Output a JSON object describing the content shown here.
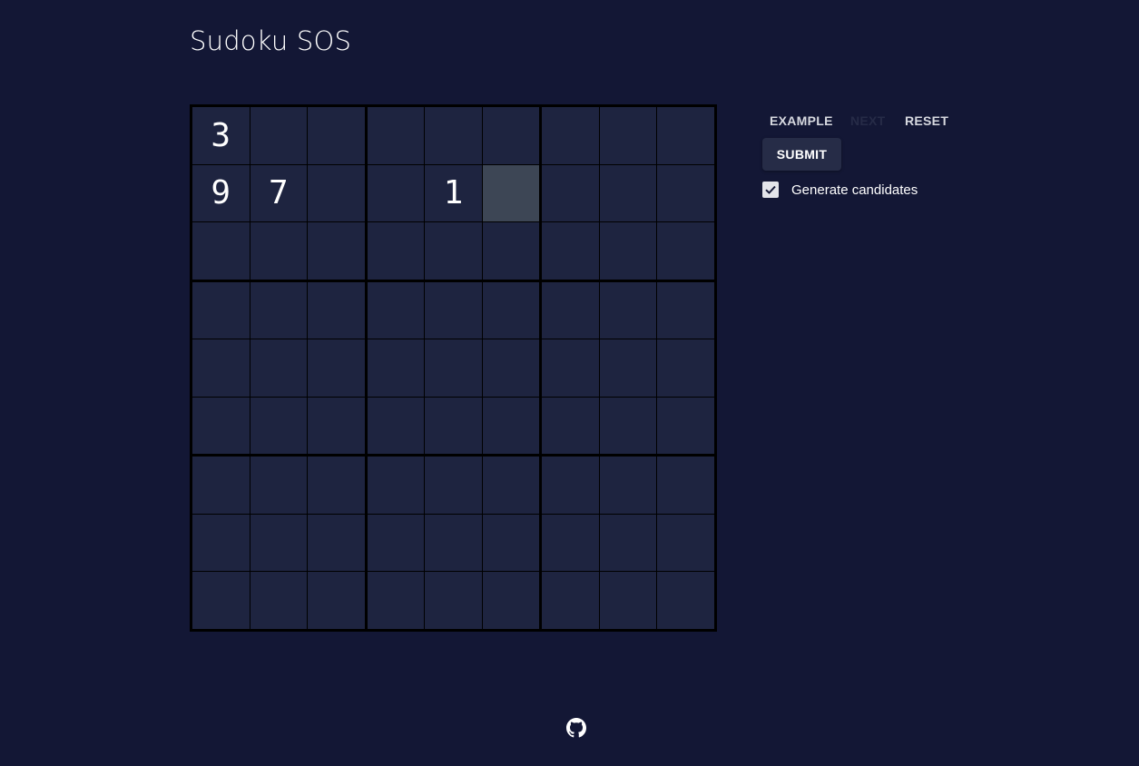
{
  "app": {
    "title": "Sudoku SOS"
  },
  "board": {
    "cells": [
      [
        "3",
        "",
        "",
        "",
        "",
        "",
        "",
        "",
        ""
      ],
      [
        "9",
        "7",
        "",
        "",
        "1",
        "",
        "",
        "",
        ""
      ],
      [
        "",
        "",
        "",
        "",
        "",
        "",
        "",
        "",
        ""
      ],
      [
        "",
        "",
        "",
        "",
        "",
        "",
        "",
        "",
        ""
      ],
      [
        "",
        "",
        "",
        "",
        "",
        "",
        "",
        "",
        ""
      ],
      [
        "",
        "",
        "",
        "",
        "",
        "",
        "",
        "",
        ""
      ],
      [
        "",
        "",
        "",
        "",
        "",
        "",
        "",
        "",
        ""
      ],
      [
        "",
        "",
        "",
        "",
        "",
        "",
        "",
        "",
        ""
      ],
      [
        "",
        "",
        "",
        "",
        "",
        "",
        "",
        "",
        ""
      ]
    ],
    "selected": {
      "row": 1,
      "col": 5
    }
  },
  "controls": {
    "example_label": "EXAMPLE",
    "next_label": "NEXT",
    "reset_label": "RESET",
    "submit_label": "SUBMIT",
    "generate_candidates_label": "Generate candidates",
    "generate_candidates_checked": true
  },
  "footer": {
    "icon": "github-icon"
  },
  "colors": {
    "background": "#131735",
    "cell": "#1e2440",
    "cell_selected": "#3d4655",
    "grid_lines": "#000000",
    "button": "#262c47",
    "disabled_text": "#262b47"
  }
}
